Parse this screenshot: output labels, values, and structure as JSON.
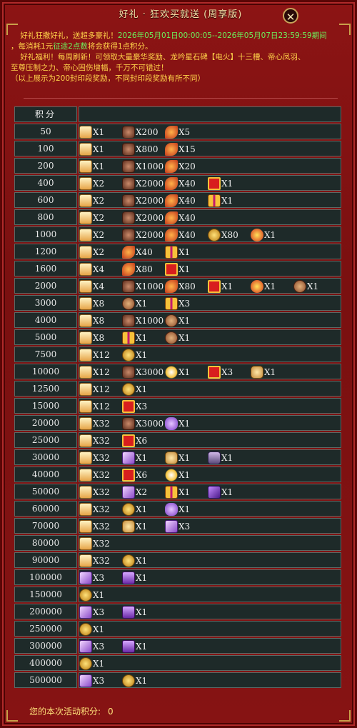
{
  "window": {
    "title": "好礼 · 狂欢买就送 (周享版)",
    "close_glyph": "✕"
  },
  "notice": {
    "line1_a": "好礼狂撒好礼，送超多豪礼！",
    "line1_b": "2026年05月01日00:00:05--2026年05月07日23:59:59期间",
    "line2_a": "，每消耗1元",
    "line2_b": "征途2点数",
    "line2_c": "将会获得1点积分。",
    "line3_a": "好礼福利！每周刷新！可领取大量豪华奖励、龙吟星石碑【电火】十三槽、帝心凤羽、",
    "line4": "至尊压制之力、帝心固伤增幅，千万不可错过！",
    "line5": "（以上展示为200封印段奖励，不同封印段奖励有所不同）"
  },
  "table": {
    "header_points": "积分",
    "rows": [
      {
        "points": "50",
        "rewards": [
          {
            "icon": "scroll-icon",
            "count": "X1"
          },
          {
            "icon": "stone-icon",
            "count": "X200"
          },
          {
            "icon": "feather-icon",
            "count": "X5"
          }
        ]
      },
      {
        "points": "100",
        "rewards": [
          {
            "icon": "scroll-icon",
            "count": "X1"
          },
          {
            "icon": "stone-icon",
            "count": "X800"
          },
          {
            "icon": "feather-icon",
            "count": "X15"
          }
        ]
      },
      {
        "points": "200",
        "rewards": [
          {
            "icon": "scroll-icon",
            "count": "X1"
          },
          {
            "icon": "stone-icon",
            "count": "X1000"
          },
          {
            "icon": "feather-icon",
            "count": "X20"
          }
        ]
      },
      {
        "points": "400",
        "rewards": [
          {
            "icon": "scroll-icon",
            "count": "X2"
          },
          {
            "icon": "stone-icon",
            "count": "X2000"
          },
          {
            "icon": "feather-icon",
            "count": "X40"
          },
          {
            "icon": "redbox-icon",
            "count": "X1"
          }
        ]
      },
      {
        "points": "600",
        "rewards": [
          {
            "icon": "scroll-icon",
            "count": "X2"
          },
          {
            "icon": "stone-icon",
            "count": "X2000"
          },
          {
            "icon": "feather-icon",
            "count": "X40"
          },
          {
            "icon": "giftbox-icon",
            "count": "X1"
          }
        ]
      },
      {
        "points": "800",
        "rewards": [
          {
            "icon": "scroll-icon",
            "count": "X2"
          },
          {
            "icon": "stone-icon",
            "count": "X2000"
          },
          {
            "icon": "feather-icon",
            "count": "X40"
          }
        ]
      },
      {
        "points": "1000",
        "rewards": [
          {
            "icon": "scroll-icon",
            "count": "X2"
          },
          {
            "icon": "stone-icon",
            "count": "X2000"
          },
          {
            "icon": "feather-icon",
            "count": "X40"
          },
          {
            "icon": "goldcoin-icon",
            "count": "X80"
          },
          {
            "icon": "fireorb-icon",
            "count": "X1"
          }
        ]
      },
      {
        "points": "1200",
        "rewards": [
          {
            "icon": "scroll-icon",
            "count": "X2"
          },
          {
            "icon": "feather-icon",
            "count": "X40"
          },
          {
            "icon": "giftbox-icon",
            "count": "X1"
          }
        ]
      },
      {
        "points": "1600",
        "rewards": [
          {
            "icon": "scroll-icon",
            "count": "X4"
          },
          {
            "icon": "feather-icon",
            "count": "X80"
          },
          {
            "icon": "redbox-icon",
            "count": "X1"
          }
        ]
      },
      {
        "points": "2000",
        "rewards": [
          {
            "icon": "scroll-icon",
            "count": "X4"
          },
          {
            "icon": "stone-icon",
            "count": "X1000"
          },
          {
            "icon": "feather-icon",
            "count": "X80"
          },
          {
            "icon": "redbox-icon",
            "count": "X1"
          },
          {
            "icon": "fireorb-icon",
            "count": "X1"
          },
          {
            "icon": "copper-icon",
            "count": "X1"
          }
        ]
      },
      {
        "points": "3000",
        "rewards": [
          {
            "icon": "scroll-icon",
            "count": "X8"
          },
          {
            "icon": "copper-icon",
            "count": "X1"
          },
          {
            "icon": "giftbox-icon",
            "count": "X3"
          }
        ]
      },
      {
        "points": "4000",
        "rewards": [
          {
            "icon": "scroll-icon",
            "count": "X8"
          },
          {
            "icon": "stone-icon",
            "count": "X1000"
          },
          {
            "icon": "copper-icon",
            "count": "X1"
          }
        ]
      },
      {
        "points": "5000",
        "rewards": [
          {
            "icon": "scroll-icon",
            "count": "X8"
          },
          {
            "icon": "giftbox-icon",
            "count": "X1"
          },
          {
            "icon": "copper-icon",
            "count": "X1"
          }
        ]
      },
      {
        "points": "7500",
        "rewards": [
          {
            "icon": "scroll-icon",
            "count": "X12"
          },
          {
            "icon": "goldcoin-icon",
            "count": "X1"
          }
        ]
      },
      {
        "points": "10000",
        "rewards": [
          {
            "icon": "scroll-icon",
            "count": "X12"
          },
          {
            "icon": "stone-icon",
            "count": "X3000"
          },
          {
            "icon": "spark-icon",
            "count": "X1"
          },
          {
            "icon": "redbox-icon",
            "count": "X3"
          },
          {
            "icon": "badge-icon",
            "count": "X1"
          }
        ]
      },
      {
        "points": "12500",
        "rewards": [
          {
            "icon": "scroll-icon",
            "count": "X12"
          },
          {
            "icon": "goldcoin-icon",
            "count": "X1"
          }
        ]
      },
      {
        "points": "15000",
        "rewards": [
          {
            "icon": "scroll-icon",
            "count": "X12"
          },
          {
            "icon": "redbox-icon",
            "count": "X3"
          }
        ]
      },
      {
        "points": "20000",
        "rewards": [
          {
            "icon": "scroll-icon",
            "count": "X32"
          },
          {
            "icon": "stone-icon",
            "count": "X3000"
          },
          {
            "icon": "purplegem-icon",
            "count": "X1"
          }
        ]
      },
      {
        "points": "25000",
        "rewards": [
          {
            "icon": "scroll-icon",
            "count": "X32"
          },
          {
            "icon": "redbox-icon",
            "count": "X6"
          }
        ]
      },
      {
        "points": "30000",
        "rewards": [
          {
            "icon": "scroll-icon",
            "count": "X32"
          },
          {
            "icon": "card-icon",
            "count": "X1"
          },
          {
            "icon": "badge-icon",
            "count": "X1"
          },
          {
            "icon": "mask-icon",
            "count": "X1"
          }
        ]
      },
      {
        "points": "40000",
        "rewards": [
          {
            "icon": "scroll-icon",
            "count": "X32"
          },
          {
            "icon": "redbox-icon",
            "count": "X6"
          },
          {
            "icon": "spark-icon",
            "count": "X1"
          }
        ]
      },
      {
        "points": "50000",
        "rewards": [
          {
            "icon": "scroll-icon",
            "count": "X32"
          },
          {
            "icon": "card-icon",
            "count": "X2"
          },
          {
            "icon": "giftbox-icon",
            "count": "X1"
          },
          {
            "icon": "purplecard-icon",
            "count": "X1"
          }
        ]
      },
      {
        "points": "60000",
        "rewards": [
          {
            "icon": "scroll-icon",
            "count": "X32"
          },
          {
            "icon": "goldcoin-icon",
            "count": "X1"
          },
          {
            "icon": "purplegem-icon",
            "count": "X1"
          }
        ]
      },
      {
        "points": "70000",
        "rewards": [
          {
            "icon": "scroll-icon",
            "count": "X32"
          },
          {
            "icon": "badge-icon",
            "count": "X1"
          },
          {
            "icon": "card-icon",
            "count": "X3"
          }
        ]
      },
      {
        "points": "80000",
        "rewards": [
          {
            "icon": "scroll-icon",
            "count": "X32"
          }
        ]
      },
      {
        "points": "90000",
        "rewards": [
          {
            "icon": "scroll-icon",
            "count": "X32"
          },
          {
            "icon": "goldcoin-icon",
            "count": "X1"
          }
        ]
      },
      {
        "points": "100000",
        "rewards": [
          {
            "icon": "card-icon",
            "count": "X3"
          },
          {
            "icon": "purplebox-icon",
            "count": "X1"
          }
        ]
      },
      {
        "points": "150000",
        "rewards": [
          {
            "icon": "goldcoin-icon",
            "count": "X1"
          }
        ]
      },
      {
        "points": "200000",
        "rewards": [
          {
            "icon": "card-icon",
            "count": "X3"
          },
          {
            "icon": "purplebox-icon",
            "count": "X1"
          }
        ]
      },
      {
        "points": "250000",
        "rewards": [
          {
            "icon": "goldcoin-icon",
            "count": "X1"
          }
        ]
      },
      {
        "points": "300000",
        "rewards": [
          {
            "icon": "card-icon",
            "count": "X3"
          },
          {
            "icon": "purplebox-icon",
            "count": "X1"
          }
        ]
      },
      {
        "points": "400000",
        "rewards": [
          {
            "icon": "goldcoin-icon",
            "count": "X1"
          }
        ]
      },
      {
        "points": "500000",
        "rewards": [
          {
            "icon": "card-icon",
            "count": "X3"
          },
          {
            "icon": "goldcoin-icon",
            "count": "X1"
          }
        ]
      }
    ]
  },
  "footer": {
    "score_label": "您的本次活动积分:",
    "score_value": "0"
  }
}
